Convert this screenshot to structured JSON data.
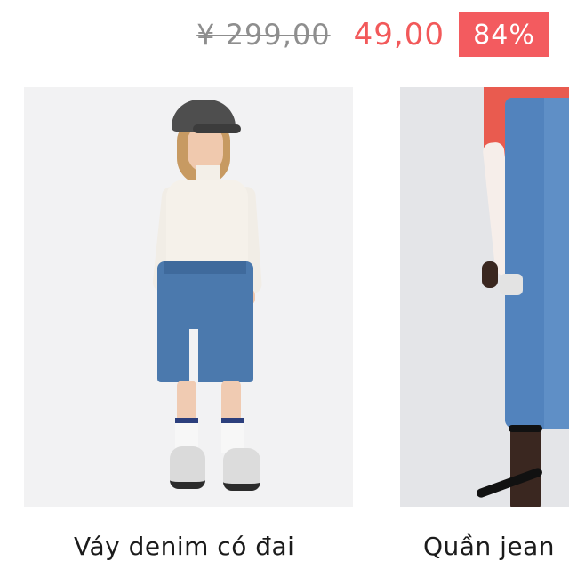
{
  "price": {
    "old": "¥ 299,00",
    "current": "49,00",
    "discount": "84%"
  },
  "products": [
    {
      "title": "Váy denim có đai",
      "image_alt": "Model wearing cream turtleneck, denim midi skirt with belt and slit, black cap and sneakers"
    },
    {
      "title": "Quần jean",
      "image_alt": "Cropped view of model wearing blue ripped straight jeans with black heeled sandals"
    }
  ],
  "colors": {
    "price_red": "#f2595a",
    "badge_bg": "#f35b5f",
    "old_price_gray": "#8e8e8e"
  }
}
